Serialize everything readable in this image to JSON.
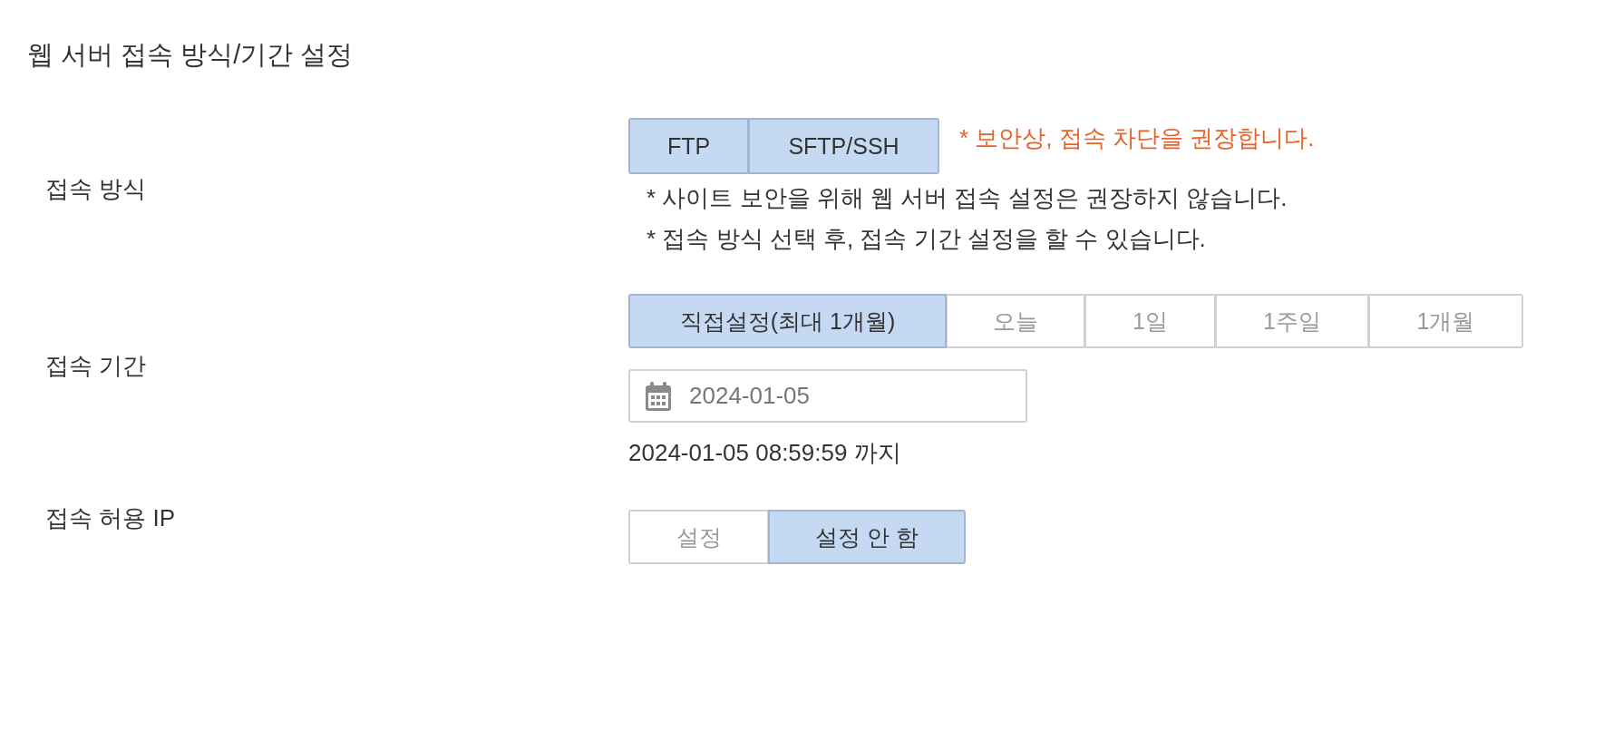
{
  "title": "웹 서버 접속 방식/기간 설정",
  "access_method": {
    "label": "접속 방식",
    "options": [
      {
        "label": "FTP",
        "selected": true
      },
      {
        "label": "SFTP/SSH",
        "selected": true
      }
    ],
    "warning": "* 보안상, 접속 차단을 권장합니다.",
    "notes": [
      "* 사이트 보안을 위해 웹 서버 접속 설정은 권장하지 않습니다.",
      "* 접속 방식 선택 후, 접속 기간 설정을 할 수 있습니다."
    ]
  },
  "access_period": {
    "label": "접속 기간",
    "options": [
      {
        "label": "직접설정(최대 1개월)",
        "selected": true
      },
      {
        "label": "오늘",
        "selected": false
      },
      {
        "label": "1일",
        "selected": false
      },
      {
        "label": "1주일",
        "selected": false
      },
      {
        "label": "1개월",
        "selected": false
      }
    ],
    "date_field": {
      "value": "2024-01-05"
    },
    "until": "2024-01-05 08:59:59 까지"
  },
  "allowed_ip": {
    "label": "접속 허용 IP",
    "options": [
      {
        "label": "설정",
        "selected": false
      },
      {
        "label": "설정 안 함",
        "selected": true
      }
    ]
  }
}
